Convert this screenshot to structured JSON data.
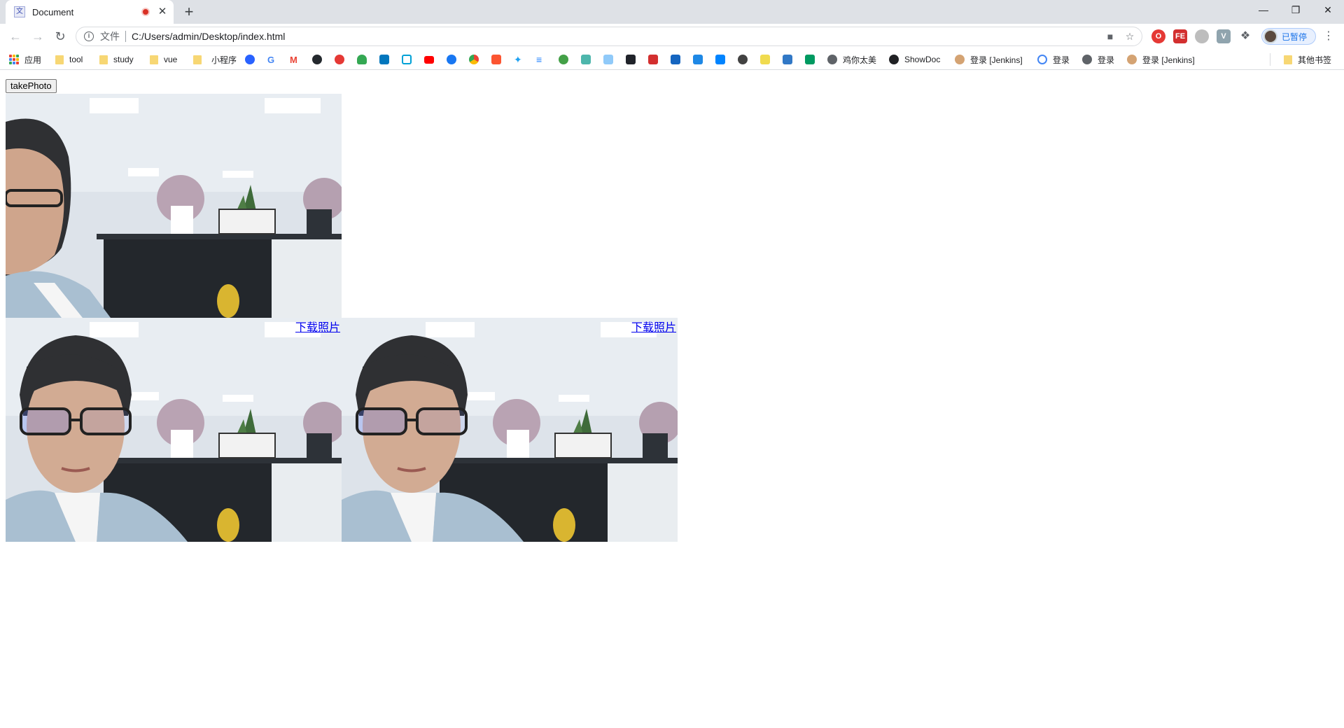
{
  "browser": {
    "tab_title": "Document",
    "tab_favicon": "document-favicon",
    "new_tab_symbol": "+",
    "window_controls": {
      "minimize": "—",
      "restore": "❐",
      "close": "✕"
    },
    "omnibox": {
      "scheme_label": "文件",
      "url": "C:/Users/admin/Desktop/index.html"
    },
    "profile_label": "已暂停"
  },
  "bookmarks": {
    "apps_label": "应用",
    "items": [
      {
        "label": "tool",
        "icon": "folder-icon"
      },
      {
        "label": "study",
        "icon": "folder-icon"
      },
      {
        "label": "vue",
        "icon": "folder-icon"
      },
      {
        "label": "小程序",
        "icon": "folder-icon"
      },
      {
        "label": "",
        "icon": "baidu-icon"
      },
      {
        "label": "",
        "icon": "google-icon"
      },
      {
        "label": "",
        "icon": "gmail-icon"
      },
      {
        "label": "",
        "icon": "github-icon"
      },
      {
        "label": "",
        "icon": "site-icon"
      },
      {
        "label": "",
        "icon": "cloud-icon"
      },
      {
        "label": "",
        "icon": "site-icon"
      },
      {
        "label": "",
        "icon": "bilibili-icon"
      },
      {
        "label": "",
        "icon": "youtube-icon"
      },
      {
        "label": "",
        "icon": "facebook-icon"
      },
      {
        "label": "",
        "icon": "chrome-icon"
      },
      {
        "label": "",
        "icon": "csdn-icon"
      },
      {
        "label": "",
        "icon": "twitter-icon"
      },
      {
        "label": "",
        "icon": "juejin-icon"
      },
      {
        "label": "",
        "icon": "site-icon"
      },
      {
        "label": "",
        "icon": "site-icon"
      },
      {
        "label": "",
        "icon": "site-icon"
      },
      {
        "label": "",
        "icon": "react-icon"
      },
      {
        "label": "",
        "icon": "site-icon"
      },
      {
        "label": "",
        "icon": "site-icon"
      },
      {
        "label": "",
        "icon": "site-icon"
      },
      {
        "label": "",
        "icon": "zhihu-icon"
      },
      {
        "label": "",
        "icon": "site-icon"
      },
      {
        "label": "",
        "icon": "es-icon"
      },
      {
        "label": "",
        "icon": "ts-icon"
      },
      {
        "label": "",
        "icon": "segmentfault-icon"
      },
      {
        "label": "鸡你太美",
        "icon": "globe-icon"
      },
      {
        "label": "ShowDoc",
        "icon": "showdoc-icon"
      },
      {
        "label": "登录 [Jenkins]",
        "icon": "jenkins-icon"
      },
      {
        "label": "登录",
        "icon": "site-icon"
      },
      {
        "label": "登录",
        "icon": "globe-icon"
      },
      {
        "label": "登录 [Jenkins]",
        "icon": "jenkins-icon"
      }
    ],
    "other_label": "其他书签"
  },
  "page": {
    "take_photo_label": "takePhoto",
    "download_label_1": "下载照片",
    "download_label_2": "下载照片"
  },
  "colors": {
    "link": "#0000ee",
    "tabstrip": "#dee1e6",
    "accent": "#1a73e8"
  }
}
